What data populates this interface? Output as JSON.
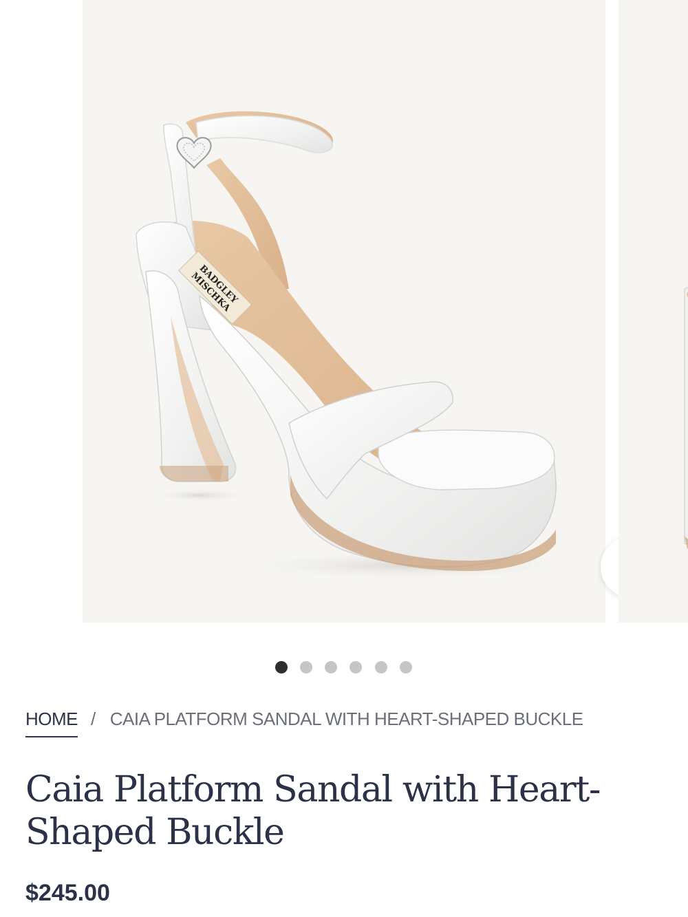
{
  "gallery": {
    "brand_label": "BADGLEY MISCHKA",
    "zoom_icon": "search-icon",
    "slide_count": 6,
    "active_slide": 1
  },
  "breadcrumb": {
    "home": "HOME",
    "separator": "/",
    "current": "CAIA PLATFORM SANDAL WITH HEART-SHAPED BUCKLE"
  },
  "product": {
    "title_line1": "Caia Platform Sandal with Heart-",
    "title_line2": "Shaped Buckle",
    "price": "$245.00"
  },
  "colors": {
    "text": "#2c3347",
    "image_bg": "#f6f5f2",
    "dot_active": "#2e2e2e",
    "dot_inactive": "#c6c6c6"
  }
}
